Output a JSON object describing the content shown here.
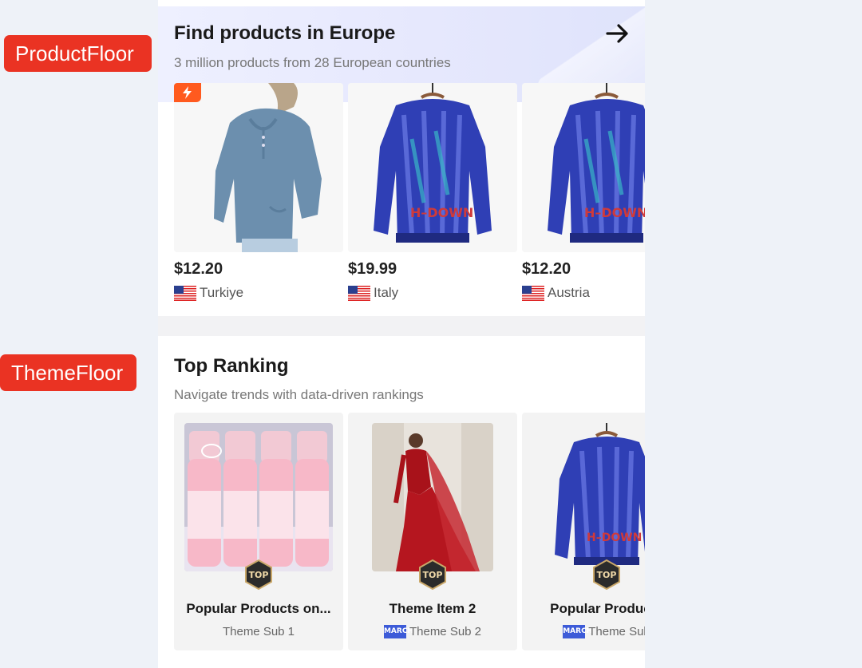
{
  "labels": {
    "product_floor": "ProductFloor",
    "theme_floor": "ThemeFloor"
  },
  "product_floor": {
    "title": "Find products in Europe",
    "subtitle": "3 million products from 28 European countries",
    "items": [
      {
        "price": "$12.20",
        "country": "Turkiye"
      },
      {
        "price": "$19.99",
        "country": "Italy"
      },
      {
        "price": "$12.20",
        "country": "Austria"
      }
    ]
  },
  "theme_floor": {
    "title": "Top Ranking",
    "subtitle": "Navigate trends with data-driven rankings",
    "badge_text": "TOP",
    "march_text": "MARCH",
    "items": [
      {
        "name": "Popular Products on...",
        "sub": "Theme Sub 1"
      },
      {
        "name": "Theme Item 2",
        "sub": "Theme Sub 2"
      },
      {
        "name": "Popular Products",
        "sub": "Theme Sub"
      }
    ]
  },
  "colors": {
    "label_red": "#ea3323",
    "accent_orange": "#ff5a1f",
    "march_blue": "#3d5bd8"
  }
}
